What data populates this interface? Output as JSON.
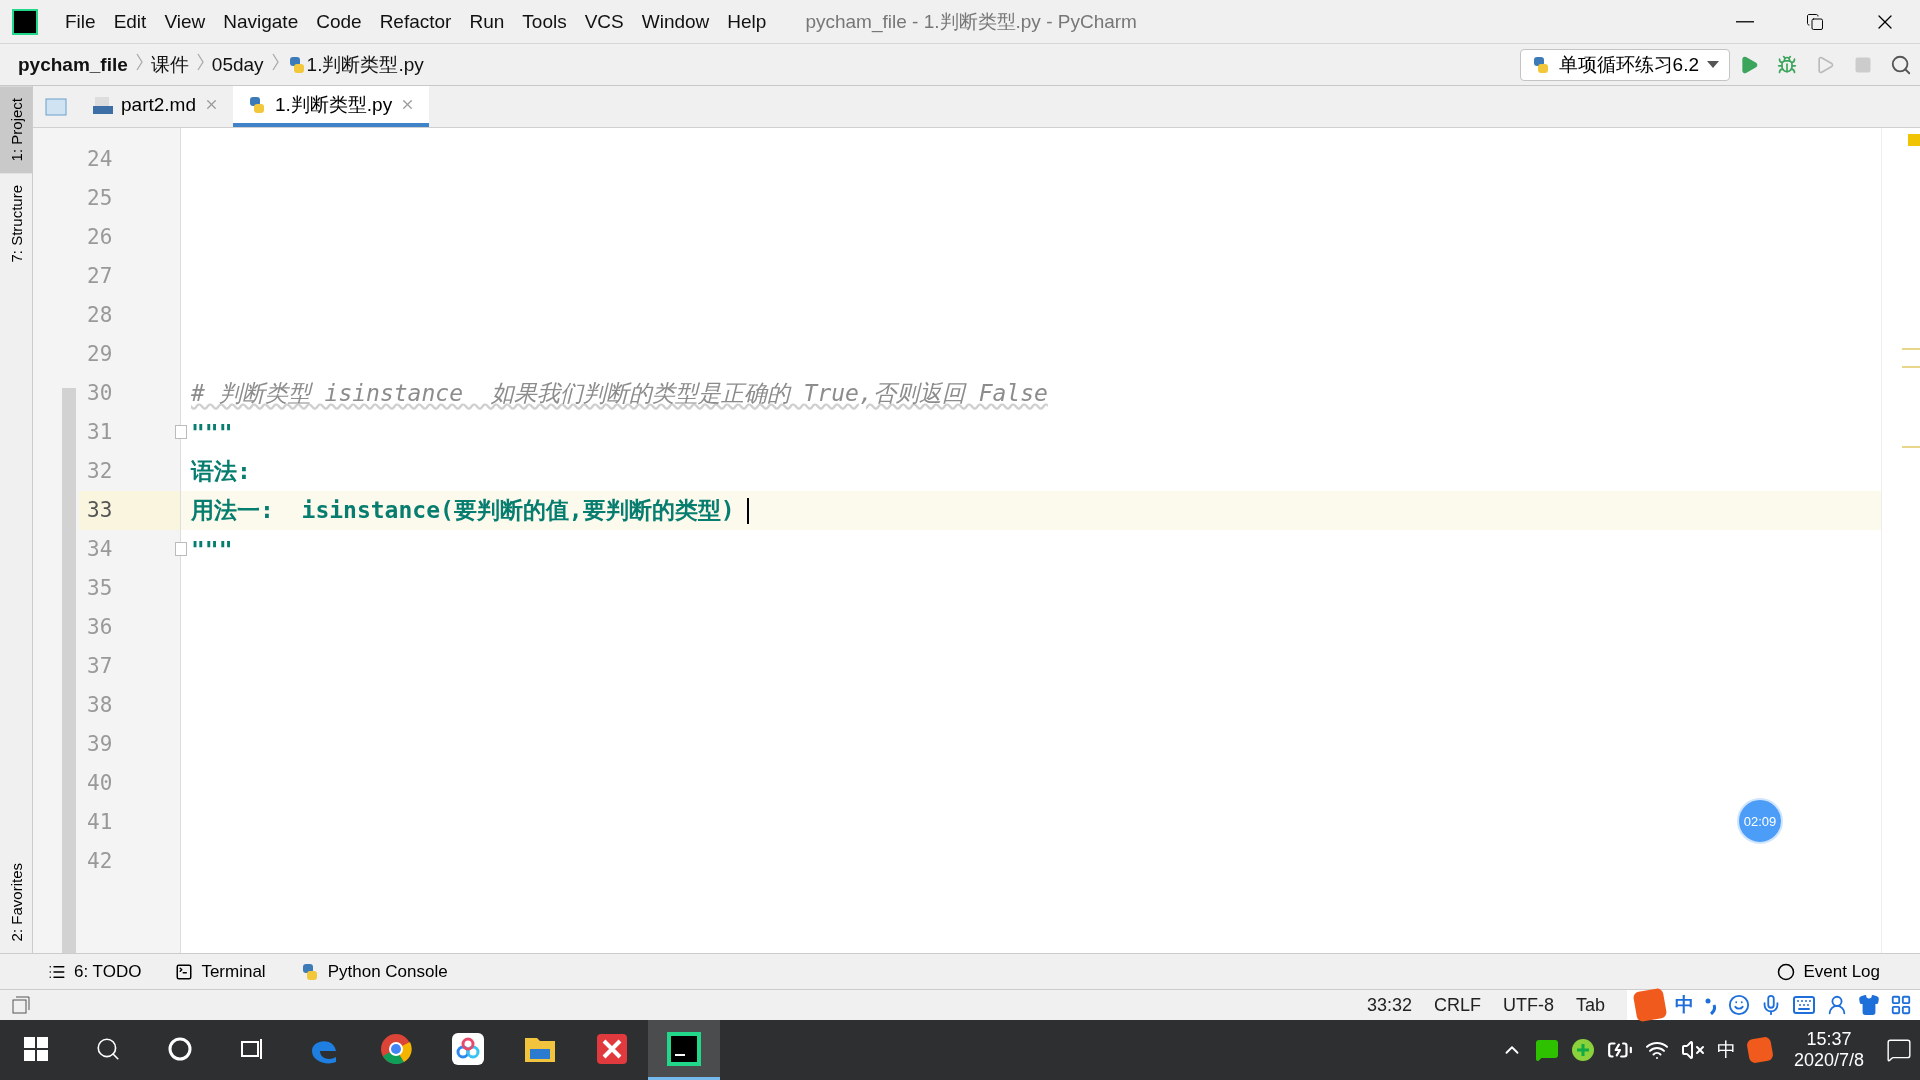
{
  "window": {
    "title": "pycham_file - 1.判断类型.py - PyCharm"
  },
  "menu": [
    {
      "label": "File"
    },
    {
      "label": "Edit"
    },
    {
      "label": "View"
    },
    {
      "label": "Navigate"
    },
    {
      "label": "Code"
    },
    {
      "label": "Refactor"
    },
    {
      "label": "Run"
    },
    {
      "label": "Tools"
    },
    {
      "label": "VCS"
    },
    {
      "label": "Window"
    },
    {
      "label": "Help"
    }
  ],
  "breadcrumbs": [
    {
      "label": "pycham_file",
      "kind": "project"
    },
    {
      "label": "课件",
      "kind": "folder"
    },
    {
      "label": "05day",
      "kind": "folder"
    },
    {
      "label": "1.判断类型.py",
      "kind": "file"
    }
  ],
  "run_config": {
    "label": "单项循环练习6.2"
  },
  "side_tabs": [
    {
      "label": "1: Project",
      "selected": true
    },
    {
      "label": "7: Structure",
      "selected": false
    },
    {
      "label": "2: Favorites",
      "selected": false
    }
  ],
  "editor_tabs": [
    {
      "label": "part2.md",
      "kind": "md",
      "selected": false
    },
    {
      "label": "1.判断类型.py",
      "kind": "py",
      "selected": true
    }
  ],
  "lines": [
    {
      "number": "24",
      "current": false
    },
    {
      "number": "25",
      "current": false
    },
    {
      "number": "26",
      "current": false
    },
    {
      "number": "27",
      "current": false
    },
    {
      "number": "28",
      "current": false
    },
    {
      "number": "29",
      "current": false
    },
    {
      "number": "30",
      "current": false,
      "kind": "comment",
      "text": "# 判断类型 isinstance  如果我们判断的类型是正确的 True,否则返回 False"
    },
    {
      "number": "31",
      "current": false,
      "kind": "string",
      "text": "\"\"\"",
      "fold": true
    },
    {
      "number": "32",
      "current": false,
      "kind": "string",
      "text": "语法:"
    },
    {
      "number": "33",
      "current": true,
      "kind": "string",
      "text": "用法一:  isinstance(要判断的值,要判断的类型)"
    },
    {
      "number": "34",
      "current": false,
      "kind": "string",
      "text": "\"\"\"",
      "fold": true
    },
    {
      "number": "35",
      "current": false
    },
    {
      "number": "36",
      "current": false
    },
    {
      "number": "37",
      "current": false
    },
    {
      "number": "38",
      "current": false
    },
    {
      "number": "39",
      "current": false
    },
    {
      "number": "40",
      "current": false
    },
    {
      "number": "41",
      "current": false
    },
    {
      "number": "42",
      "current": false
    }
  ],
  "timer": "02:09",
  "tool_windows": [
    {
      "label": "6: TODO",
      "kind": "todo"
    },
    {
      "label": "Terminal",
      "kind": "terminal"
    },
    {
      "label": "Python Console",
      "kind": "console"
    }
  ],
  "event_log": "Event Log",
  "status": {
    "position": "33:32",
    "line_ending": "CRLF",
    "encoding": "UTF-8",
    "indent": "Tab"
  },
  "ime_bar": {
    "mode": "中"
  },
  "taskbar": {
    "apps": [
      {
        "kind": "edge",
        "selected": false
      },
      {
        "kind": "chrome",
        "selected": false
      },
      {
        "kind": "cloud",
        "selected": false
      },
      {
        "kind": "folder",
        "selected": false
      },
      {
        "kind": "xmind",
        "selected": false
      },
      {
        "kind": "pycharm",
        "selected": true
      }
    ],
    "ime": "中",
    "time": "15:37",
    "date": "2020/7/8"
  }
}
